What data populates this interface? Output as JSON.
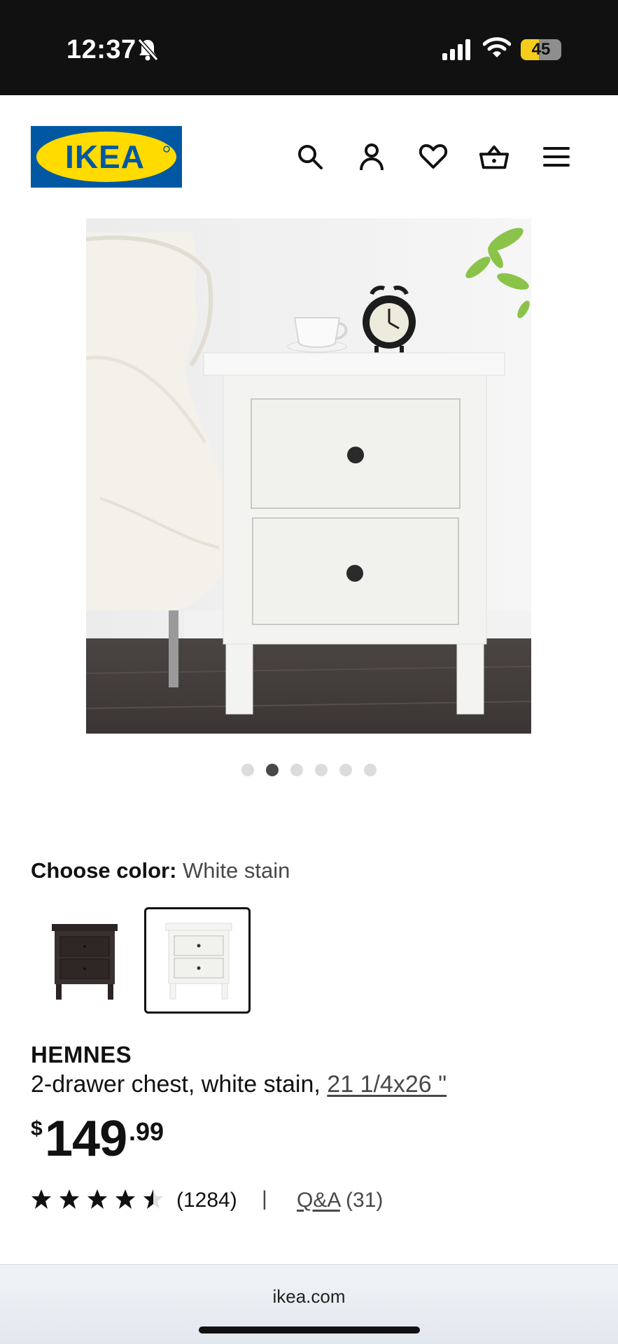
{
  "status_bar": {
    "time": "12:37",
    "battery_level": "45",
    "battery_fraction": 0.45,
    "icons": [
      "bell-slash-icon",
      "cellular-signal-icon",
      "wifi-icon",
      "battery-icon"
    ]
  },
  "header": {
    "logo_text": "IKEA",
    "logo_colors": {
      "blue": "#0058a3",
      "yellow": "#ffdb00"
    },
    "nav_icons": [
      "search-icon",
      "account-icon",
      "heart-icon",
      "cart-icon",
      "menu-icon"
    ]
  },
  "gallery": {
    "image_count": 6,
    "active_index": 1
  },
  "color_chooser": {
    "label": "Choose color:",
    "selected_value": "White stain",
    "swatches": [
      {
        "name": "black-brown",
        "selected": false
      },
      {
        "name": "white-stain",
        "selected": true
      }
    ]
  },
  "product": {
    "name": "HEMNES",
    "description": "2-drawer chest, white stain, ",
    "size": "21 1/4x26 \"",
    "price": {
      "currency": "$",
      "integer": "149",
      "decimal": ".99"
    },
    "rating": {
      "value": 4.5,
      "out_of": 5,
      "count": "(1284)"
    },
    "separator": "|",
    "qa_label": "Q&A",
    "qa_count": " (31)"
  },
  "browser": {
    "url": "ikea.com"
  }
}
